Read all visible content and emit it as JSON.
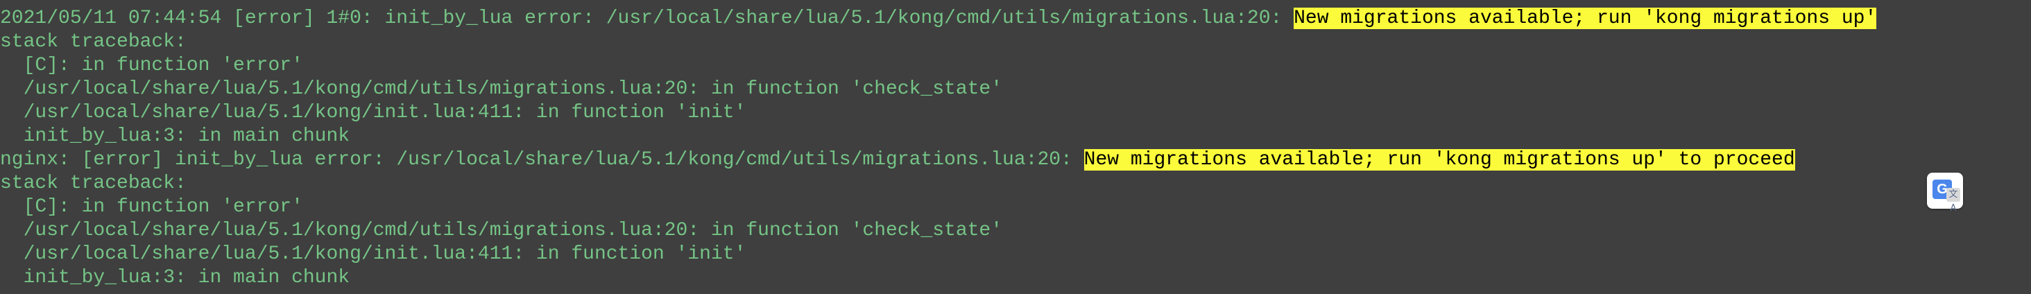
{
  "log": {
    "lines": [
      {
        "prefix": "2021/05/11 07:44:54 [error] 1#0: init_by_lua error: /usr/local/share/lua/5.1/kong/cmd/utils/migrations.lua:20: ",
        "highlight": "New migrations available; run 'kong migrations up'"
      },
      {
        "text": "stack traceback:"
      },
      {
        "text": "  [C]: in function 'error'"
      },
      {
        "text": "  /usr/local/share/lua/5.1/kong/cmd/utils/migrations.lua:20: in function 'check_state'"
      },
      {
        "text": "  /usr/local/share/lua/5.1/kong/init.lua:411: in function 'init'"
      },
      {
        "text": "  init_by_lua:3: in main chunk"
      },
      {
        "prefix": "nginx: [error] init_by_lua error: /usr/local/share/lua/5.1/kong/cmd/utils/migrations.lua:20: ",
        "highlight": "New migrations available; run 'kong migrations up' to proceed"
      },
      {
        "text": "stack traceback:"
      },
      {
        "text": "  [C]: in function 'error'"
      },
      {
        "text": "  /usr/local/share/lua/5.1/kong/cmd/utils/migrations.lua:20: in function 'check_state'"
      },
      {
        "text": "  /usr/local/share/lua/5.1/kong/init.lua:411: in function 'init'"
      },
      {
        "text": "  init_by_lua:3: in main chunk"
      }
    ]
  },
  "translate_badge": {
    "icon": "google-translate-icon",
    "glyph": "G",
    "sub_glyph": "文A"
  },
  "colors": {
    "background": "#3f3f3f",
    "text": "#75c486",
    "highlight_bg": "#fbfb3b",
    "highlight_text": "#000000"
  }
}
